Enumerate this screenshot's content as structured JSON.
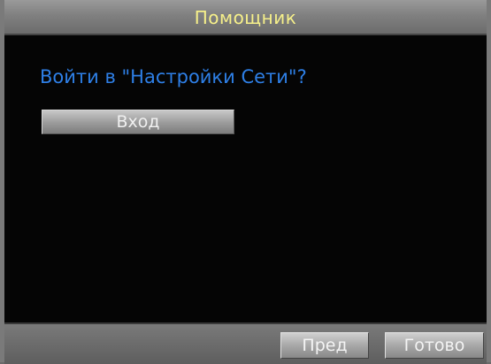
{
  "dialog": {
    "title": "Помощник",
    "prompt": "Войти в \"Настройки Сети\"?",
    "enter_label": "Вход"
  },
  "footer": {
    "prev_label": "Пред",
    "done_label": "Готово"
  },
  "colors": {
    "title_text": "#f6f08a",
    "prompt_text": "#2e7fe6",
    "background": "#050505"
  }
}
